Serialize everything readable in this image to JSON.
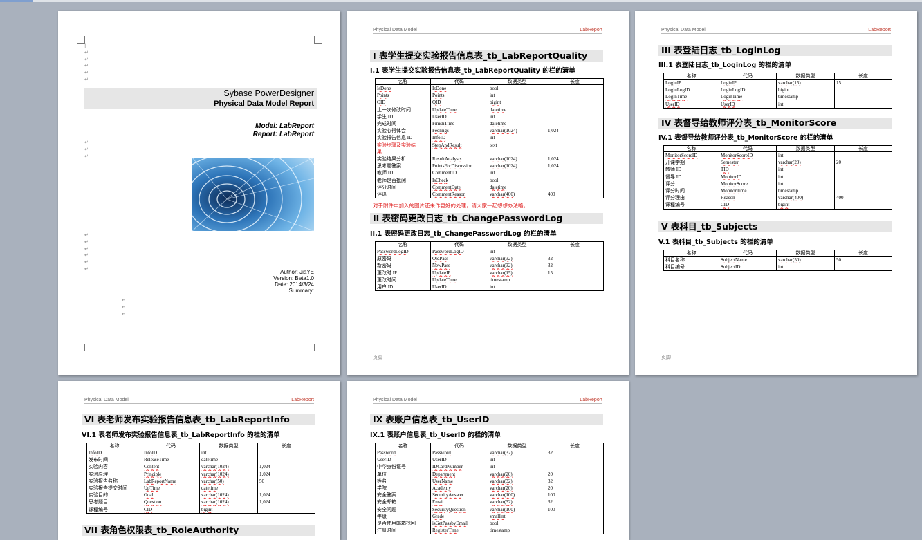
{
  "header": {
    "left": "Physical Data Model",
    "right": "LabReport"
  },
  "footer": {
    "label": "页脚"
  },
  "table_headers": [
    "名称",
    "代码",
    "数据类型",
    "长度"
  ],
  "cover": {
    "title1": "Sybase PowerDesigner",
    "title2": "Physical Data Model Report",
    "model": "Model: LabReport",
    "report": "Report: LabReport",
    "author": "Author: JiaYE",
    "version": "Version: Beta1.0",
    "date": "Date: 2014/3/24",
    "summary": "Summary:"
  },
  "sections": {
    "s1": {
      "h1": "I 表学生提交实验报告信息表_tb_LabReportQuality",
      "h2": "I.1 表学生提交实验报告信息表_tb_LabReportQuality 的栏的清单",
      "rows": [
        [
          "IsDone",
          "IsDone",
          "bool",
          ""
        ],
        [
          "Points",
          "Points",
          "int",
          ""
        ],
        [
          "QID",
          "QID",
          "bigint",
          ""
        ],
        [
          "上一次修改时间",
          "UpdateTime",
          "datetime",
          ""
        ],
        [
          "学生 ID",
          "UserID",
          "int",
          ""
        ],
        [
          "完成时间",
          "FinishTime",
          "datetime",
          ""
        ],
        [
          "实验心得体会",
          "Feelings",
          "varchar(1024)",
          "1,024"
        ],
        [
          "实验报告信息 ID",
          "InfoID",
          "int",
          ""
        ],
        [
          "实验步骤及实验结",
          "StepAndResult",
          "text",
          ""
        ],
        [
          "果",
          "",
          "",
          ""
        ],
        [
          "实验结果分析",
          "ResultAnalysis",
          "varchar(1024)",
          "1,024"
        ],
        [
          "思考题答案",
          "PointsForDiscussion",
          "varchar(1024)",
          "1,024"
        ],
        [
          "教师 ID",
          "CommentID",
          "int",
          ""
        ],
        [
          "老师是否批阅",
          "IsCheck",
          "bool",
          ""
        ],
        [
          "评分时间",
          "CommentDate",
          "datetime",
          ""
        ],
        [
          "评语",
          "CommentReason",
          "varchar(400)",
          "400"
        ]
      ],
      "note": "对于附件中加入的图片还未作更好的处理，请大家一起想想办法咯。"
    },
    "s2": {
      "h1": "II 表密码更改日志_tb_ChangePasswordLog",
      "h2": "II.1 表密码更改日志_tb_ChangePasswordLog 的栏的清单",
      "rows": [
        [
          "PasswordLogID",
          "PasswordLogID",
          "int",
          ""
        ],
        [
          "原密码",
          "OldPass",
          "varchar(32)",
          "32"
        ],
        [
          "新密码",
          "NewPass",
          "varchar(32)",
          "32"
        ],
        [
          "更改时 IP",
          "UpdateIP",
          "varchar(15)",
          "15"
        ],
        [
          "更改时间",
          "UpdateTime",
          "timestamp",
          ""
        ],
        [
          "用户 ID",
          "UserID",
          "int",
          ""
        ]
      ]
    },
    "s3": {
      "h1": "III 表登陆日志_tb_LoginLog",
      "h2": "III.1 表登陆日志_tb_LoginLog 的栏的清单",
      "rows": [
        [
          "LoginIP",
          "LoginIP",
          "varchar(15)",
          "15"
        ],
        [
          "LoginLogID",
          "LoginLogID",
          "bigint",
          ""
        ],
        [
          "LoginTime",
          "LoginTime",
          "timestamp",
          ""
        ],
        [
          "UserID",
          "UserID",
          "int",
          ""
        ]
      ]
    },
    "s4": {
      "h1": "IV 表督导给教师评分表_tb_MonitorScore",
      "h2": "IV.1 表督导给教师评分表_tb_MonitorScore 的栏的清单",
      "rows": [
        [
          "MonitorScoreID",
          "MonitorScoreID",
          "int",
          ""
        ],
        [
          "开课学期",
          "Semester",
          "varchar(20)",
          "20"
        ],
        [
          "教师 ID",
          "TID",
          "int",
          ""
        ],
        [
          "督导 ID",
          "MonitorID",
          "int",
          ""
        ],
        [
          "评分",
          "MonitorScore",
          "int",
          ""
        ],
        [
          "评分时间",
          "MonitorTime",
          "timestamp",
          ""
        ],
        [
          "评分理由",
          "Reason",
          "varchar(400)",
          "400"
        ],
        [
          "课程编号",
          "CID",
          "bigint",
          ""
        ]
      ]
    },
    "s5": {
      "h1": "V 表科目_tb_Subjects",
      "h2": "V.1 表科目_tb_Subjects 的栏的清单",
      "rows": [
        [
          "科目名称",
          "SubjectName",
          "varchar(50)",
          "50"
        ],
        [
          "科目编号",
          "SubjectID",
          "int",
          ""
        ]
      ]
    },
    "s6": {
      "h1": "VI 表老师发布实验报告信息表_tb_LabReportInfo",
      "h2": "VI.1 表老师发布实验报告信息表_tb_LabReportInfo 的栏的清单",
      "rows": [
        [
          "InfoID",
          "InfoID",
          "int",
          ""
        ],
        [
          "发布时间",
          "ReleaseTime",
          "datetime",
          ""
        ],
        [
          "实验内容",
          "Content",
          "varchar(1024)",
          "1,024"
        ],
        [
          "实验原理",
          "Principle",
          "varchar(1024)",
          "1,024"
        ],
        [
          "实验报告名称",
          "LabReportName",
          "varchar(50)",
          "50"
        ],
        [
          "实验报告提交时间",
          "UpTime",
          "datetime",
          ""
        ],
        [
          "实验目的",
          "Goal",
          "varchar(1024)",
          "1,024"
        ],
        [
          "思考题目",
          "Question",
          "varchar(1024)",
          "1,024"
        ],
        [
          "课程编号",
          "CID",
          "bigint",
          ""
        ]
      ],
      "next_h1": "VII 表角色权限表_tb_RoleAuthority"
    },
    "s9": {
      "h1": "IX 表账户信息表_tb_UserID",
      "h2": "IX.1 表账户信息表_tb_UserID 的栏的清单",
      "rows": [
        [
          "Password",
          "Password",
          "varchar(32)",
          "32"
        ],
        [
          "UserID",
          "UserID",
          "int",
          ""
        ],
        [
          "中华身份证号",
          "IDCardNumber",
          "int",
          ""
        ],
        [
          "单位",
          "Department",
          "varchar(20)",
          "20"
        ],
        [
          "姓名",
          "UserName",
          "varchar(32)",
          "32"
        ],
        [
          "学院",
          "Academy",
          "varchar(20)",
          "20"
        ],
        [
          "安全答案",
          "SecurityAnswer",
          "varchar(100)",
          "100"
        ],
        [
          "安全邮箱",
          "Email",
          "varchar(32)",
          "32"
        ],
        [
          "安全问题",
          "SecurityQuestion",
          "varchar(100)",
          "100"
        ],
        [
          "年级",
          "Grade",
          "smallint",
          ""
        ],
        [
          "是否使用邮箱找回",
          "isGetPassbyEmail",
          "bool",
          ""
        ],
        [
          "注册时间",
          "RegisterTime",
          "timestamp",
          ""
        ]
      ]
    }
  }
}
